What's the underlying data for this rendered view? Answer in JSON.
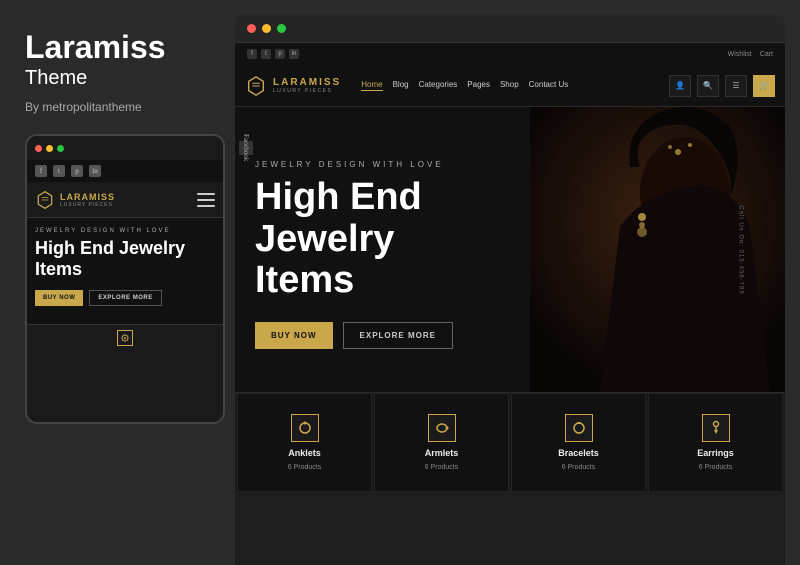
{
  "leftPanel": {
    "title": "Laramiss",
    "subtitle": "Theme",
    "author": "By metropolitantheme"
  },
  "mobileMockup": {
    "dots": [
      "red",
      "yellow",
      "green"
    ],
    "socialIcons": [
      "f",
      "t",
      "p",
      "in"
    ],
    "logoName": "LARAMISS",
    "logoSub": "LUXURY PIECES",
    "heroLabel": "JEWELRY DESIGN WITH LOVE",
    "heroTitle": "High End Jewelry Items",
    "buttons": {
      "buy": "BUY NOW",
      "explore": "EXPLORE MORE"
    }
  },
  "desktopMockup": {
    "dots": [
      "red",
      "yellow",
      "green"
    ],
    "topBar": {
      "socialIcons": [
        "f",
        "t",
        "p",
        "in"
      ],
      "links": [
        "Wishlist",
        "Cart"
      ]
    },
    "nav": {
      "logoName": "LARAMISS",
      "logoSub": "LUXURY PIECES",
      "links": [
        "Home",
        "Blog",
        "Categories",
        "Pages",
        "Shop",
        "Contact Us"
      ],
      "activeLink": "Home",
      "icons": [
        "user",
        "search",
        "menu",
        "cart"
      ]
    },
    "hero": {
      "label": "JEWELRY DESIGN WITH LOVE",
      "title": "High End\nJewelry\nItems",
      "buttons": {
        "buy": "BUY NOW",
        "explore": "EXPLORE MORE"
      },
      "sideText": "Call Us On: 015-456-789"
    },
    "categories": [
      {
        "name": "Anklets",
        "count": "6 Products",
        "icon": "⬟"
      },
      {
        "name": "Armlets",
        "count": "6 Products",
        "icon": "⬟"
      },
      {
        "name": "Bracelets",
        "count": "6 Products",
        "icon": "⬟"
      },
      {
        "name": "Earrings",
        "count": "6 Products",
        "icon": "⬟"
      }
    ]
  }
}
